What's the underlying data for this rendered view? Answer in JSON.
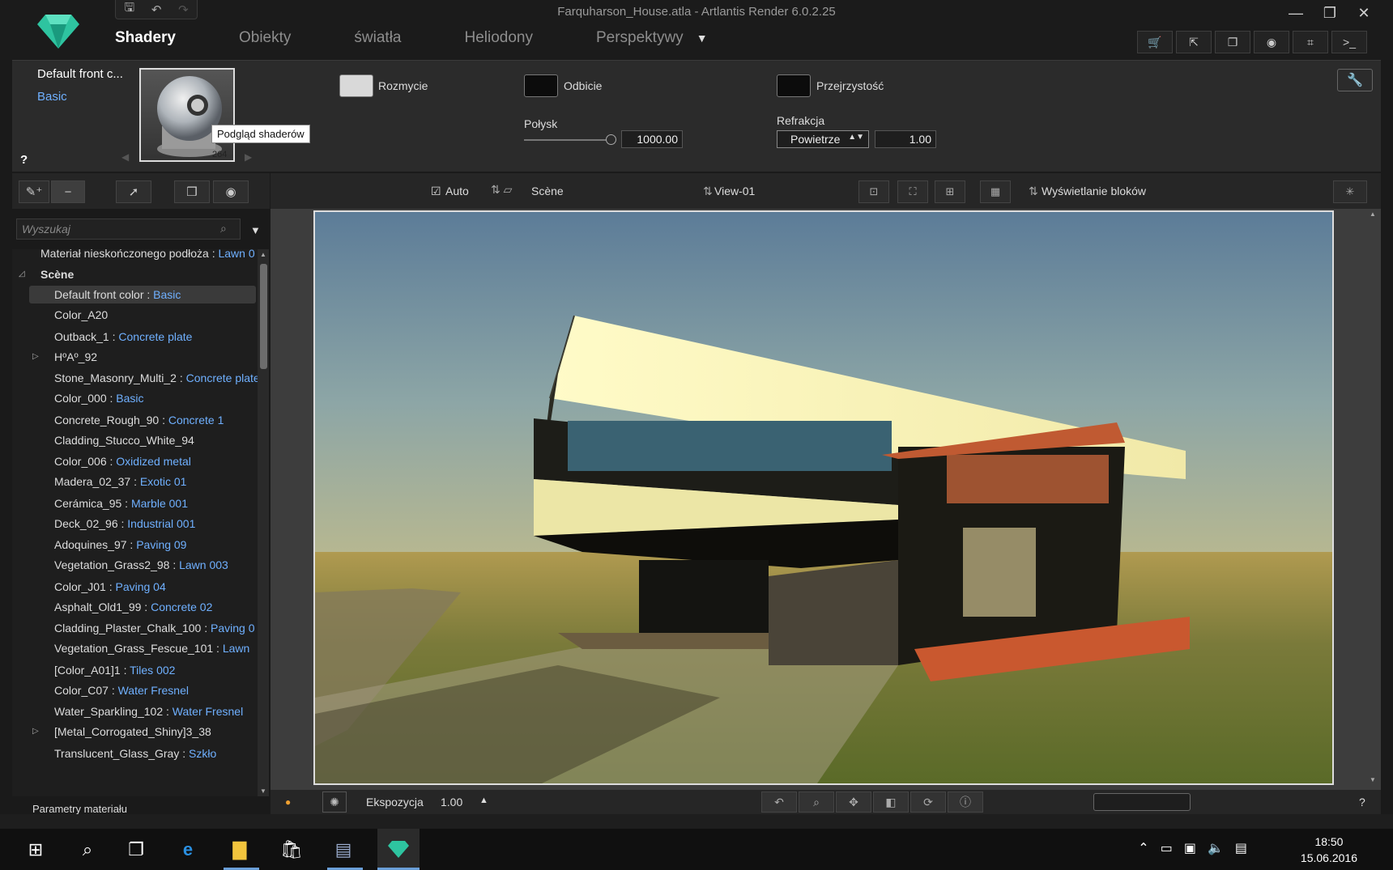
{
  "window": {
    "title": "Farquharson_House.atla - Artlantis Render 6.0.2.25",
    "controls": {
      "minimize": "—",
      "restore": "❐",
      "close": "✕"
    }
  },
  "nav": {
    "tabs": [
      "Shadery",
      "Obiekty",
      "światła",
      "Heliodony",
      "Perspektywy"
    ],
    "active": "Shadery",
    "dropdown_glyph": "▼"
  },
  "shader": {
    "name": "Default front c...",
    "type": "Basic",
    "preview_tooltip": "Podgląd shaderów",
    "preview_number": "264",
    "blur_label": "Rozmycie",
    "reflection_label": "Odbicie",
    "transparency_label": "Przejrzystość",
    "gloss_label": "Połysk",
    "gloss_value": "1000.00",
    "refraction_label": "Refrakcja",
    "refraction_medium": "Powietrze",
    "refraction_value": "1.00",
    "help": "?"
  },
  "tree": {
    "search_placeholder": "Wyszukaj",
    "top_item": {
      "name": "Materiał nieskończonego podłoża : ",
      "sub": "Lawn 0"
    },
    "group": "Scène",
    "items": [
      {
        "name": "Default front color : ",
        "sub": "Basic",
        "selected": true
      },
      {
        "name": "Color_A20",
        "sub": ""
      },
      {
        "name": "Outback_1 : ",
        "sub": "Concrete plate"
      },
      {
        "name": "HºAº_92",
        "sub": "",
        "expandable": true
      },
      {
        "name": "Stone_Masonry_Multi_2 : ",
        "sub": "Concrete plate"
      },
      {
        "name": "Color_000 : ",
        "sub": "Basic"
      },
      {
        "name": "Concrete_Rough_90 : ",
        "sub": "Concrete 1"
      },
      {
        "name": "Cladding_Stucco_White_94",
        "sub": ""
      },
      {
        "name": "Color_006 : ",
        "sub": "Oxidized metal"
      },
      {
        "name": "Madera_02_37 : ",
        "sub": "Exotic 01"
      },
      {
        "name": "Cerámica_95 : ",
        "sub": "Marble 001"
      },
      {
        "name": "Deck_02_96 : ",
        "sub": "Industrial 001"
      },
      {
        "name": "Adoquines_97 : ",
        "sub": "Paving 09"
      },
      {
        "name": "Vegetation_Grass2_98 : ",
        "sub": "Lawn 003"
      },
      {
        "name": "Color_J01 : ",
        "sub": "Paving 04"
      },
      {
        "name": "Asphalt_Old1_99 : ",
        "sub": "Concrete 02"
      },
      {
        "name": "Cladding_Plaster_Chalk_100 : ",
        "sub": "Paving 0"
      },
      {
        "name": "Vegetation_Grass_Fescue_101 : ",
        "sub": "Lawn"
      },
      {
        "name": "[Color_A01]1 : ",
        "sub": "Tiles 002"
      },
      {
        "name": "Color_C07 : ",
        "sub": "Water Fresnel"
      },
      {
        "name": "Water_Sparkling_102 : ",
        "sub": "Water Fresnel"
      },
      {
        "name": "[Metal_Corrogated_Shiny]3_38",
        "sub": "",
        "expandable": true
      },
      {
        "name": "Translucent_Glass_Gray : ",
        "sub": "Szkło"
      }
    ],
    "params_label": "Parametry materiału"
  },
  "viewport": {
    "auto_label": "Auto",
    "scene_label": "Scène",
    "view_label": "View-01",
    "display_label": "Wyświetlanie bloków",
    "exposure_label": "Ekspozycja",
    "exposure_value": "1.00",
    "help": "?"
  },
  "taskbar": {
    "time": "18:50",
    "date": "15.06.2016"
  },
  "colors": {
    "accent_link": "#6fb0ff",
    "selected_row": "#3a3a3a",
    "logo": "#2ec4a0"
  }
}
